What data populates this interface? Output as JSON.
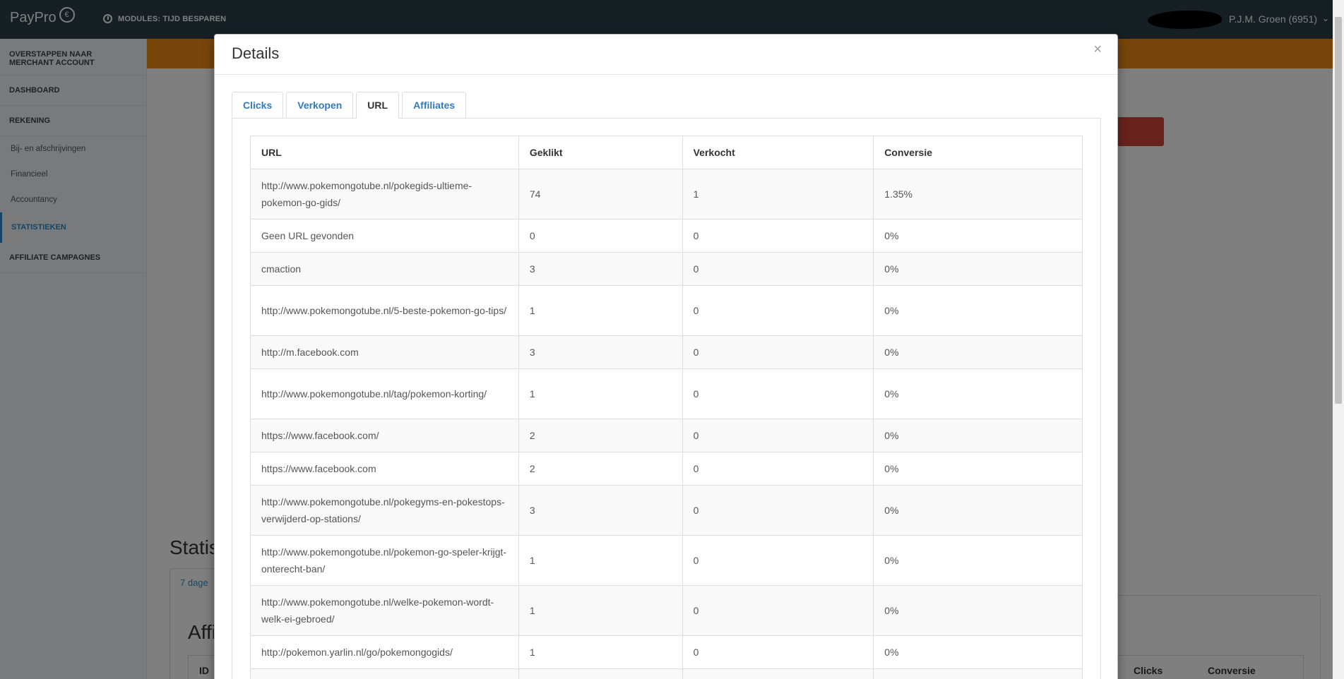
{
  "header": {
    "logo": "PayPro",
    "modules_label": "MODULES: TIJD BESPAREN",
    "user": "P.J.M. Groen (6951)"
  },
  "sidebar": {
    "switch_account": "OVERSTAPPEN NAAR MERCHANT ACCOUNT",
    "dashboard": "DASHBOARD",
    "rekening": "REKENING",
    "sub_items": [
      "Bij- en afschrijvingen",
      "Financieel",
      "Accountancy"
    ],
    "statistieken": "STATISTIEKEN",
    "affiliate": "AFFILIATE CAMPAGNES"
  },
  "background": {
    "stats_heading": "Statis",
    "tab_label": "7 dage",
    "affi_heading": "Affi",
    "col_id": "ID",
    "col_clicks": "Clicks",
    "col_conversie": "Conversie"
  },
  "modal": {
    "title": "Details",
    "close": "×",
    "tabs": [
      "Clicks",
      "Verkopen",
      "URL",
      "Affiliates"
    ],
    "active_tab": "URL",
    "table": {
      "headers": [
        "URL",
        "Geklikt",
        "Verkocht",
        "Conversie"
      ],
      "rows": [
        [
          "http://www.pokemongotube.nl/pokegids-ultieme-pokemon-go-gids/",
          "74",
          "1",
          "1.35%"
        ],
        [
          "Geen URL gevonden",
          "0",
          "0",
          "0%"
        ],
        [
          "cmaction",
          "3",
          "0",
          "0%"
        ],
        [
          "http://www.pokemongotube.nl/5-beste-pokemon-go-tips/",
          "1",
          "0",
          "0%"
        ],
        [
          "http://m.facebook.com",
          "3",
          "0",
          "0%"
        ],
        [
          "http://www.pokemongotube.nl/tag/pokemon-korting/",
          "1",
          "0",
          "0%"
        ],
        [
          "https://www.facebook.com/",
          "2",
          "0",
          "0%"
        ],
        [
          "https://www.facebook.com",
          "2",
          "0",
          "0%"
        ],
        [
          "http://www.pokemongotube.nl/pokegyms-en-pokestops-verwijderd-op-stations/",
          "3",
          "0",
          "0%"
        ],
        [
          "http://www.pokemongotube.nl/pokemon-go-speler-krijgt-onterecht-ban/",
          "1",
          "0",
          "0%"
        ],
        [
          "http://www.pokemongotube.nl/welke-pokemon-wordt-welk-ei-gebroed/",
          "1",
          "0",
          "0%"
        ],
        [
          "http://pokemon.yarlin.nl/go/pokemongogids/",
          "1",
          "0",
          "0%"
        ]
      ]
    }
  }
}
